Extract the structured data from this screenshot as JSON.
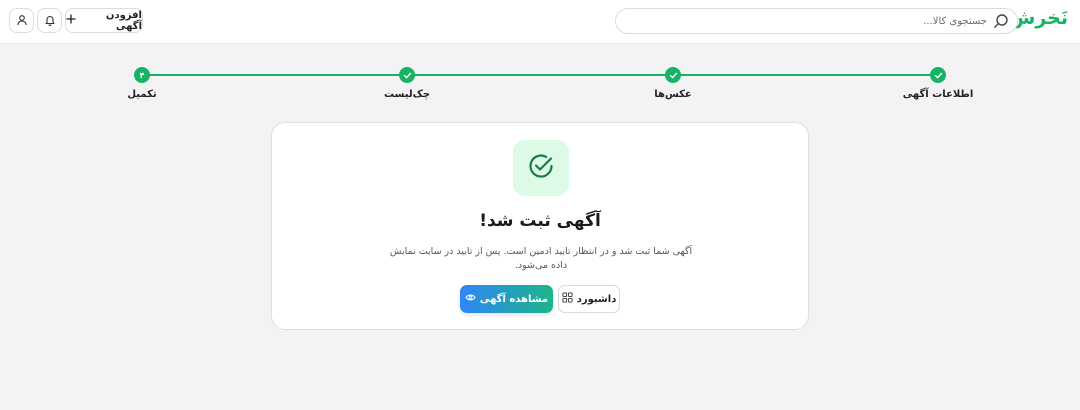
{
  "header": {
    "logo": "نَخرش",
    "search_placeholder": "جستجوی کالا...",
    "add_label": "افزودن آگهی"
  },
  "stepper": {
    "steps": [
      {
        "label": "اطلاعات آگهی",
        "state": "done"
      },
      {
        "label": "عکس‌ها",
        "state": "done"
      },
      {
        "label": "چک‌لیست",
        "state": "done"
      },
      {
        "label": "تکمیل",
        "state": "current",
        "number": "۴"
      }
    ]
  },
  "card": {
    "title": "آگهی ثبت شد!",
    "message": "آگهی شما ثبت شد و در انتظار تایید ادمین است. پس از تایید در سایت نمایش داده می‌شود.",
    "view_button": "مشاهده آگهی",
    "dashboard_button": "داشبورد"
  },
  "colors": {
    "accent": "#16b364",
    "success_bg": "#dcfae6",
    "gradient_start": "#2f86f6",
    "gradient_end": "#1bb58a"
  }
}
